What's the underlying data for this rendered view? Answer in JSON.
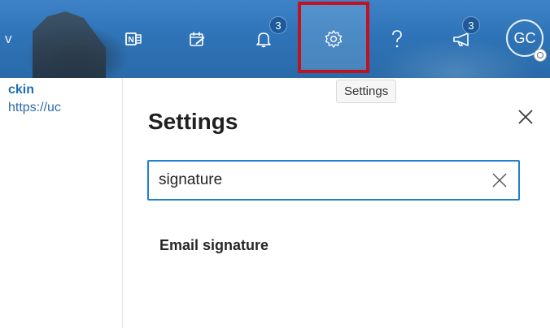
{
  "topbar": {
    "left_fragment": "v",
    "icons": [
      {
        "name": "onenote-icon"
      },
      {
        "name": "todo-icon"
      },
      {
        "name": "notifications-icon",
        "badge": "3"
      },
      {
        "name": "settings-icon"
      },
      {
        "name": "help-icon"
      },
      {
        "name": "announcements-icon",
        "badge": "3"
      }
    ],
    "avatar_initials": "GC",
    "settings_tooltip": "Settings"
  },
  "mail_snippet": {
    "sender": "ckin",
    "link": "https://uc"
  },
  "settings_panel": {
    "title": "Settings",
    "search": {
      "value": "signature"
    },
    "results": [
      "Email signature"
    ]
  },
  "colors": {
    "header_blue": "#2f74b8",
    "highlight_red": "#c1121f",
    "focus_blue": "#1f7fd0",
    "link_blue": "#1d6eb5"
  }
}
